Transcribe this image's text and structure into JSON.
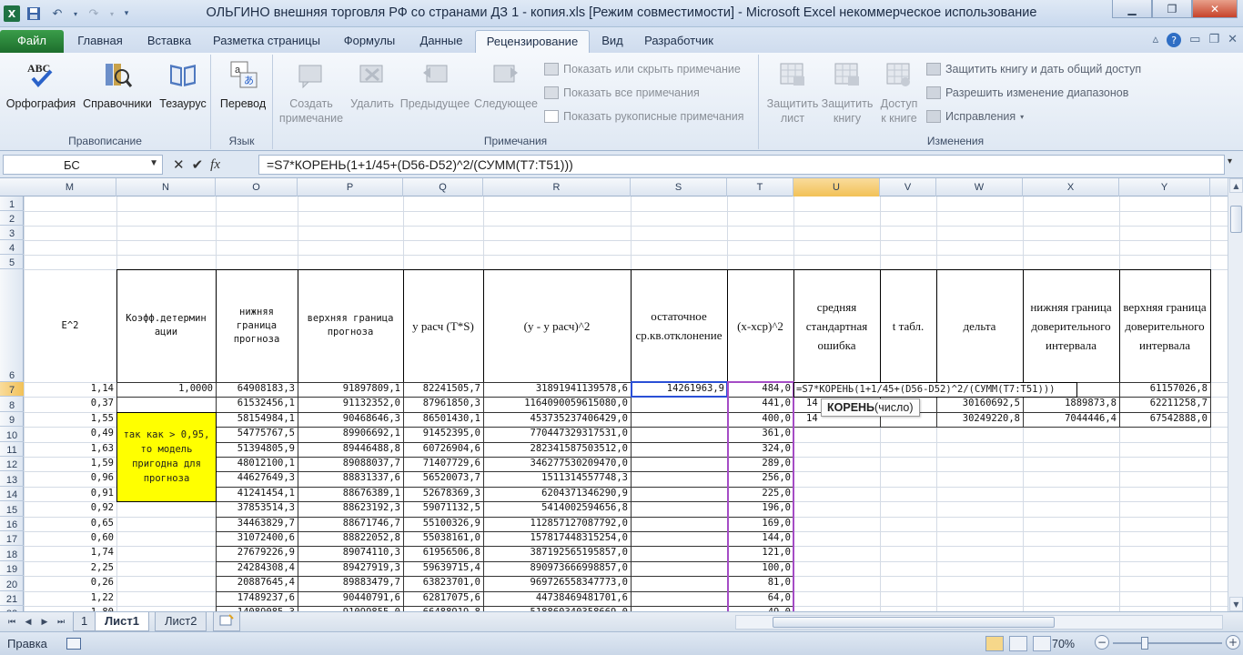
{
  "window": {
    "title": "ОЛЬГИНО внешняя торговля РФ со странами ДЗ  1 - копия.xls  [Режим совместимости]  -  Microsoft Excel некоммерческое использование",
    "minimize": "▁",
    "maximize": "❐",
    "close": "✕"
  },
  "ribbon_tabs": [
    "Файл",
    "Главная",
    "Вставка",
    "Разметка страницы",
    "Формулы",
    "Данные",
    "Рецензирование",
    "Вид",
    "Разработчик"
  ],
  "ribbon": {
    "proofing": {
      "label": "Правописание",
      "spelling": "Орфография",
      "research": "Справочники",
      "thesaurus": "Тезаурус"
    },
    "language": {
      "label": "Язык",
      "translate": "Перевод"
    },
    "comments": {
      "label": "Примечания",
      "new_line1": "Создать",
      "new_line2": "примечание",
      "delete": "Удалить",
      "previous": "Предыдущее",
      "next": "Следующее",
      "show_hide": "Показать или скрыть примечание",
      "show_all": "Показать все примечания",
      "show_ink": "Показать рукописные примечания"
    },
    "changes": {
      "label": "Изменения",
      "protect_sheet_line1": "Защитить",
      "protect_sheet_line2": "лист",
      "protect_wb_line1": "Защитить",
      "protect_wb_line2": "книгу",
      "share_line1": "Доступ",
      "share_line2": "к книге",
      "protect_share": "Защитить книгу и дать общий доступ",
      "allow_ranges": "Разрешить изменение диапазонов",
      "track": "Исправления"
    }
  },
  "formula_bar": {
    "name_box": "БС",
    "formula": "=S7*КОРЕНЬ(1+1/45+(D56-D52)^2/(СУММ(T7:T51)))"
  },
  "grid": {
    "columns": [
      "M",
      "N",
      "O",
      "P",
      "Q",
      "R",
      "S",
      "T",
      "U",
      "V",
      "W",
      "X",
      "Y"
    ],
    "selected_column": "U",
    "selected_row": "7",
    "headers": {
      "M": "E^2",
      "N": "Коэфф.детермин ации",
      "O": "нижняя граница прогноза",
      "P": "верхняя граница прогноза",
      "Q": "y расч (T*S)",
      "R": "(y - y расч)^2",
      "S": "остаточное ср.кв.отклонение",
      "T": "(x-xср)^2",
      "U": "средняя стандартная ошибка",
      "V": "t табл.",
      "W": "дельта",
      "X": "нижняя граница доверительного интервала",
      "Y": "верхняя граница доверительного интервала"
    },
    "yellow_note": "так как > 0,95, то модель пригодна для прогноза",
    "n7": "1,0000",
    "s7": "14261963,9",
    "u7_edit": "=S7*КОРЕНЬ(1+1/45+(D56-D52)^2/(СУММ(T7:T51)))",
    "u8_partial": "14",
    "u9_partial": "14",
    "tooltip_fn": "КОРЕНЬ",
    "tooltip_arg": "(число)",
    "v7": "",
    "w8": "30160692,5",
    "w9": "30249220,8",
    "x8": "1889873,8",
    "x9": "7044446,4",
    "y7": "61157026,8",
    "y8": "62211258,7",
    "y9": "67542888,0",
    "rows": [
      {
        "n": "7",
        "m": "1,14",
        "o": "64908183,3",
        "p": "91897809,1",
        "q": "82241505,7",
        "r": "31891941139578,6",
        "t": "484,0"
      },
      {
        "n": "8",
        "m": "0,37",
        "o": "61532456,1",
        "p": "91132352,0",
        "q": "87961850,3",
        "r": "1164090059615080,0",
        "t": "441,0"
      },
      {
        "n": "9",
        "m": "1,55",
        "o": "58154984,1",
        "p": "90468646,3",
        "q": "86501430,1",
        "r": "453735237406429,0",
        "t": "400,0"
      },
      {
        "n": "10",
        "m": "0,49",
        "o": "54775767,5",
        "p": "89906692,1",
        "q": "91452395,0",
        "r": "770447329317531,0",
        "t": "361,0"
      },
      {
        "n": "11",
        "m": "1,63",
        "o": "51394805,9",
        "p": "89446488,8",
        "q": "60726904,6",
        "r": "282341587503512,0",
        "t": "324,0"
      },
      {
        "n": "12",
        "m": "1,59",
        "o": "48012100,1",
        "p": "89088037,7",
        "q": "71407729,6",
        "r": "346277530209470,0",
        "t": "289,0"
      },
      {
        "n": "13",
        "m": "0,96",
        "o": "44627649,3",
        "p": "88831337,6",
        "q": "56520073,7",
        "r": "1511314557748,3",
        "t": "256,0"
      },
      {
        "n": "14",
        "m": "0,91",
        "o": "41241454,1",
        "p": "88676389,1",
        "q": "52678369,3",
        "r": "6204371346290,9",
        "t": "225,0"
      },
      {
        "n": "15",
        "m": "0,92",
        "o": "37853514,3",
        "p": "88623192,3",
        "q": "59071132,5",
        "r": "5414002594656,8",
        "t": "196,0"
      },
      {
        "n": "16",
        "m": "0,65",
        "o": "34463829,7",
        "p": "88671746,7",
        "q": "55100326,9",
        "r": "112857127087792,0",
        "t": "169,0"
      },
      {
        "n": "17",
        "m": "0,60",
        "o": "31072400,6",
        "p": "88822052,8",
        "q": "55038161,0",
        "r": "157817448315254,0",
        "t": "144,0"
      },
      {
        "n": "18",
        "m": "1,74",
        "o": "27679226,9",
        "p": "89074110,3",
        "q": "61956506,8",
        "r": "387192565195857,0",
        "t": "121,0"
      },
      {
        "n": "19",
        "m": "2,25",
        "o": "24284308,4",
        "p": "89427919,3",
        "q": "59639715,4",
        "r": "890973666998857,0",
        "t": "100,0"
      },
      {
        "n": "20",
        "m": "0,26",
        "o": "20887645,4",
        "p": "89883479,7",
        "q": "63823701,0",
        "r": "969726558347773,0",
        "t": "81,0"
      },
      {
        "n": "21",
        "m": "1,22",
        "o": "17489237,6",
        "p": "90440791,6",
        "q": "62817075,6",
        "r": "44738469481701,6",
        "t": "64,0"
      },
      {
        "n": "22",
        "m": "1,80",
        "o": "14089085,3",
        "p": "91099855,0",
        "q": "66488919,8",
        "r": "518860340358669,0",
        "t": "49,0"
      }
    ]
  },
  "sheet_tabs": {
    "partial_left": "1",
    "tabs": [
      "Лист1",
      "Лист2"
    ],
    "active": "Лист1"
  },
  "status": {
    "mode": "Правка",
    "zoom": "70%"
  }
}
